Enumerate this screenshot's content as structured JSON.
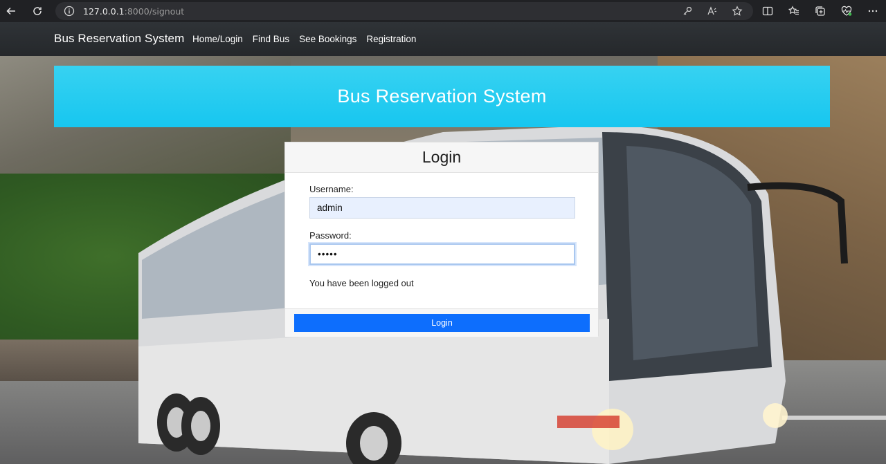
{
  "browser": {
    "url_host": "127.0.0.1",
    "url_rest": ":8000/signout",
    "icons": [
      "back-icon",
      "refresh-icon",
      "info-icon",
      "key-icon",
      "read-aloud-icon",
      "favorite-star-icon",
      "split-screen-icon",
      "favorites-icon",
      "collections-icon",
      "health-icon",
      "more-icon"
    ]
  },
  "navbar": {
    "brand": "Bus Reservation System",
    "links": [
      "Home/Login",
      "Find Bus",
      "See Bookings",
      "Registration"
    ]
  },
  "hero": {
    "title": "Bus Reservation System",
    "color": "#1ec9f1"
  },
  "login": {
    "title": "Login",
    "username_label": "Username:",
    "username_value": "admin",
    "password_label": "Password:",
    "password_value": "•••••",
    "message": "You have been logged out",
    "button_label": "Login",
    "button_color": "#0d6efd"
  }
}
